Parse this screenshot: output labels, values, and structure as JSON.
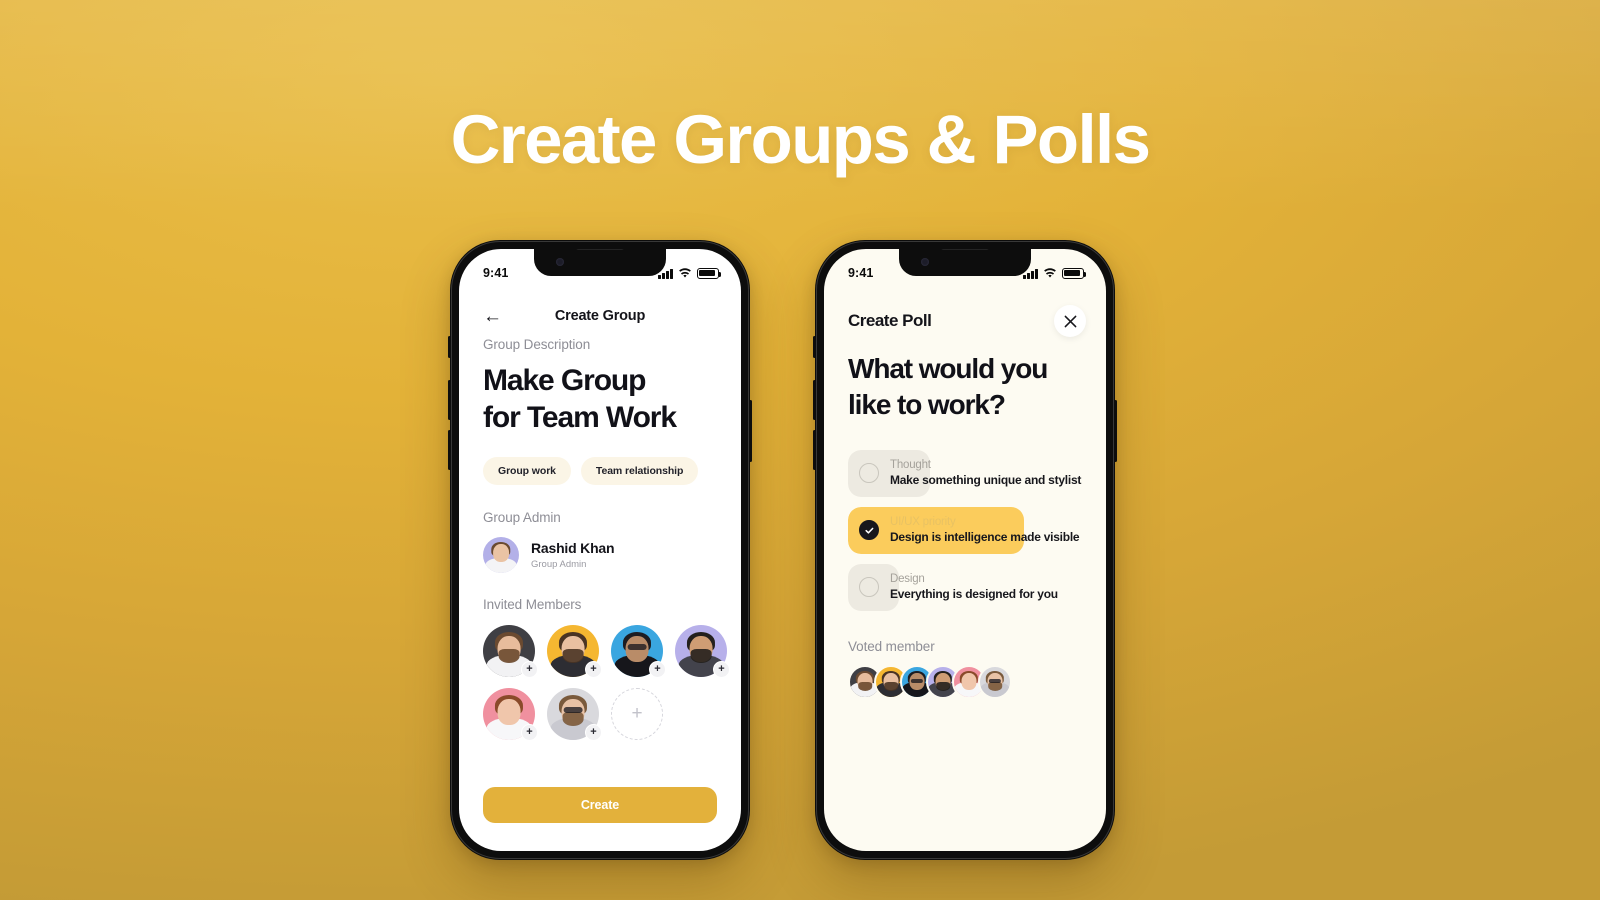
{
  "page": {
    "hero_title": "Create Groups & Polls",
    "background_color": "#e3b238",
    "accent_color": "#e3b13b"
  },
  "status_bar": {
    "time": "9:41",
    "icons": [
      "signal-icon",
      "wifi-icon",
      "battery-icon"
    ]
  },
  "left_phone": {
    "nav": {
      "back_icon": "arrow-left-icon",
      "title": "Create Group"
    },
    "description_label": "Group Description",
    "heading": "Make Group for Team Work",
    "heading_line1": "Make Group",
    "heading_line2": "for Team Work",
    "tags": [
      "Group work",
      "Team  relationship"
    ],
    "admin_label": "Group Admin",
    "admin": {
      "name": "Rashid Khan",
      "role": "Group Admin",
      "avatar_bg": "#b3b0e8"
    },
    "members_label": "Invited Members",
    "members": [
      {
        "name": "member-1",
        "bg": "#3f3f44",
        "skin": "#e7bc9c",
        "hair": "#6b4a30",
        "shirt": "#f2f2f4",
        "beard": true,
        "glasses": false,
        "add_badge": true
      },
      {
        "name": "member-2",
        "bg": "#f5b731",
        "skin": "#e9c0a1",
        "hair": "#4a3424",
        "shirt": "#2d2d33",
        "beard": true,
        "glasses": false,
        "add_badge": true
      },
      {
        "name": "member-3",
        "bg": "#3aa6e0",
        "skin": "#b98c68",
        "hair": "#1d1d22",
        "shirt": "#16161b",
        "beard": false,
        "glasses": true,
        "add_badge": true
      },
      {
        "name": "member-4",
        "bg": "#b7b0ea",
        "skin": "#cf9d74",
        "hair": "#24201d",
        "shirt": "#43434c",
        "beard": true,
        "glasses": false,
        "add_badge": true
      },
      {
        "name": "member-5",
        "bg": "#f0909f",
        "skin": "#f0c6ab",
        "hair": "#8a4a2a",
        "shirt": "#f7f7f9",
        "beard": false,
        "glasses": false,
        "add_badge": true
      },
      {
        "name": "member-6",
        "bg": "#d9d9dd",
        "skin": "#e8c2a6",
        "hair": "#7a5a3c",
        "shirt": "#c9c9d0",
        "beard": true,
        "glasses": true,
        "add_badge": true
      }
    ],
    "add_member_icon": "plus-icon",
    "create_button": "Create"
  },
  "right_phone": {
    "nav": {
      "title": "Create Poll",
      "close_icon": "close-icon"
    },
    "question": "What would you like to  work?",
    "question_line1": "What would you",
    "question_line2": "like to  work?",
    "options": [
      {
        "kicker": "Thought",
        "text": "Make something unique and stylist",
        "selected": false,
        "fill_percent": 35
      },
      {
        "kicker": "UI/UX priority",
        "text": "Design is intelligence made visible",
        "selected": true,
        "fill_percent": 75
      },
      {
        "kicker": "Design",
        "text": "Everything is designed for you",
        "selected": false,
        "fill_percent": 22
      }
    ],
    "voted_label": "Voted member",
    "voted_members": [
      {
        "name": "voter-1",
        "bg": "#3f3f44",
        "skin": "#e7bc9c",
        "hair": "#6b4a30",
        "shirt": "#f2f2f4",
        "beard": true,
        "glasses": false
      },
      {
        "name": "voter-2",
        "bg": "#f5b731",
        "skin": "#e9c0a1",
        "hair": "#4a3424",
        "shirt": "#2d2d33",
        "beard": true,
        "glasses": false
      },
      {
        "name": "voter-3",
        "bg": "#3aa6e0",
        "skin": "#b98c68",
        "hair": "#1d1d22",
        "shirt": "#16161b",
        "beard": false,
        "glasses": true
      },
      {
        "name": "voter-4",
        "bg": "#b7b0ea",
        "skin": "#cf9d74",
        "hair": "#24201d",
        "shirt": "#43434c",
        "beard": true,
        "glasses": false
      },
      {
        "name": "voter-5",
        "bg": "#f0909f",
        "skin": "#f0c6ab",
        "hair": "#8a4a2a",
        "shirt": "#f7f7f9",
        "beard": false,
        "glasses": false
      },
      {
        "name": "voter-6",
        "bg": "#d9d9dd",
        "skin": "#e8c2a6",
        "hair": "#7a5a3c",
        "shirt": "#c9c9d0",
        "beard": true,
        "glasses": true
      }
    ]
  }
}
